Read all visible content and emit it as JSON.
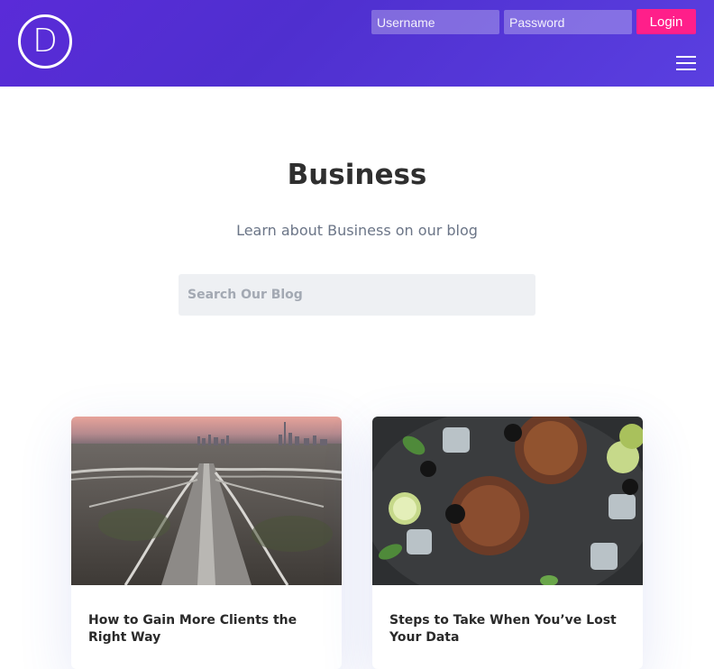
{
  "header": {
    "logo_letter": "D",
    "username_placeholder": "Username",
    "password_placeholder": "Password",
    "login_label": "Login"
  },
  "hero": {
    "title": "Business",
    "subtitle": "Learn about Business on our blog",
    "search_placeholder": "Search Our Blog"
  },
  "posts": [
    {
      "title": "How to Gain More Clients the Right Way",
      "image": "highway-city-skyline-photo"
    },
    {
      "title": "Steps to Take When You’ve Lost Your Data",
      "image": "drinks-ice-berries-photo"
    }
  ]
}
